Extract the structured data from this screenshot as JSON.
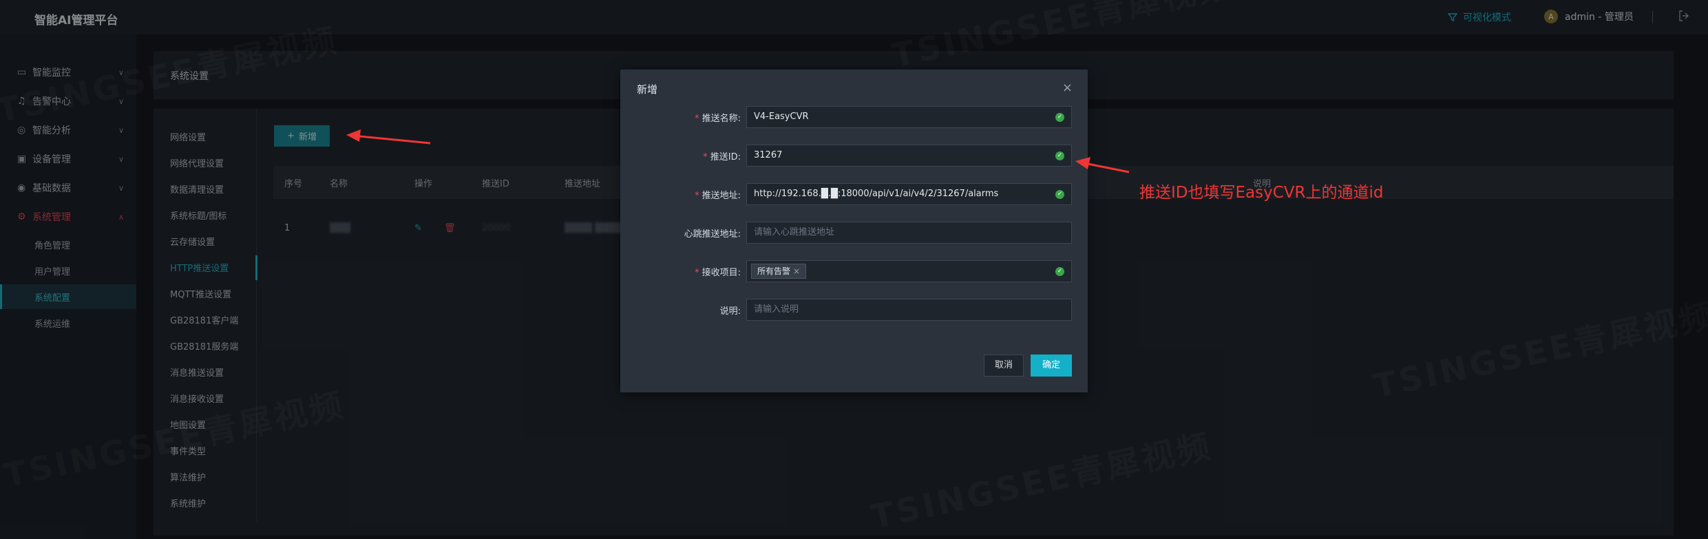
{
  "app": {
    "title": "智能AI管理平台"
  },
  "topbar": {
    "viz_mode": "可视化模式",
    "user": "admin - 管理员",
    "avatar_letter": "A"
  },
  "nav": {
    "items": [
      {
        "label": "智能监控",
        "icon": "monitor-icon"
      },
      {
        "label": "告警中心",
        "icon": "bell-icon"
      },
      {
        "label": "智能分析",
        "icon": "compass-icon"
      },
      {
        "label": "设备管理",
        "icon": "camera-icon"
      },
      {
        "label": "基础数据",
        "icon": "database-icon"
      },
      {
        "label": "系统管理",
        "icon": "gear-icon"
      }
    ],
    "sub_items": [
      "角色管理",
      "用户管理",
      "系统配置",
      "系统运维"
    ]
  },
  "breadcrumb": {
    "title": "系统设置"
  },
  "settings_menu": [
    "网络设置",
    "网络代理设置",
    "数据清理设置",
    "系统标题/图标",
    "云存储设置",
    "HTTP推送设置",
    "MQTT推送设置",
    "GB28181客户端",
    "GB28181服务端",
    "消息推送设置",
    "消息接收设置",
    "地图设置",
    "事件类型",
    "算法维护",
    "系统维护"
  ],
  "toolbar": {
    "add_label": "新增",
    "add_icon": "+"
  },
  "table": {
    "headers": [
      "序号",
      "名称",
      "操作",
      "推送ID",
      "推送地址",
      "说明"
    ],
    "rows": [
      {
        "index": "1",
        "name": "███",
        "push_id": "20000",
        "address": "████ ████"
      }
    ]
  },
  "modal": {
    "title": "新增",
    "close": "×",
    "fields": [
      {
        "label": "推送名称:",
        "required": true,
        "value": "V4-EasyCVR",
        "placeholder": "",
        "valid": true
      },
      {
        "label": "推送ID:",
        "required": true,
        "value": "31267",
        "placeholder": "",
        "valid": true
      },
      {
        "label": "推送地址:",
        "required": true,
        "value": "http://192.168.█.█:18000/api/v1/ai/v4/2/31267/alarms",
        "placeholder": "",
        "valid": true
      },
      {
        "label": "心跳推送地址:",
        "required": false,
        "value": "",
        "placeholder": "请输入心跳推送地址",
        "valid": false
      },
      {
        "label": "接收项目:",
        "required": true,
        "tag": "所有告警",
        "valid": true
      },
      {
        "label": "说明:",
        "required": false,
        "value": "",
        "placeholder": "请输入说明",
        "valid": false
      }
    ],
    "cancel_label": "取消",
    "ok_label": "确定"
  },
  "annotations": {
    "note": "推送ID也填写EasyCVR上的通道id"
  },
  "watermark": "TSINGSEE青犀视频",
  "colors": {
    "accent": "#22b8cf",
    "danger": "#e84a5a",
    "annotation": "#f03535",
    "valid": "#3aa64a"
  }
}
